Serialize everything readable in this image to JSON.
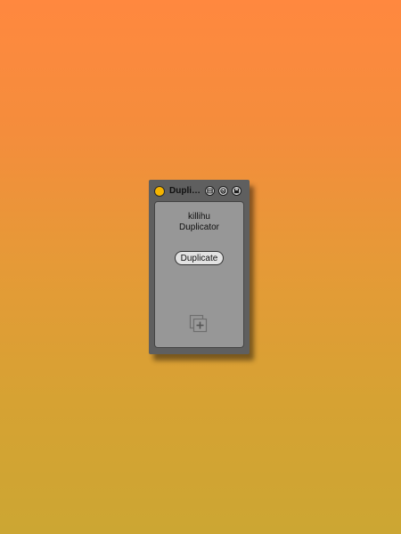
{
  "device": {
    "title": "Duplicator",
    "name_line1": "killihu",
    "name_line2": "Duplicator",
    "duplicate_label": "Duplicate"
  },
  "icons": {
    "power": "power-toggle-icon",
    "fold": "fold-icon",
    "hot_swap": "hot-swap-icon",
    "save": "save-preset-icon",
    "duplicate": "duplicate-add-icon"
  },
  "colors": {
    "power_on": "#f5b400",
    "panel": "#979797",
    "frame": "#5f5f5f"
  }
}
